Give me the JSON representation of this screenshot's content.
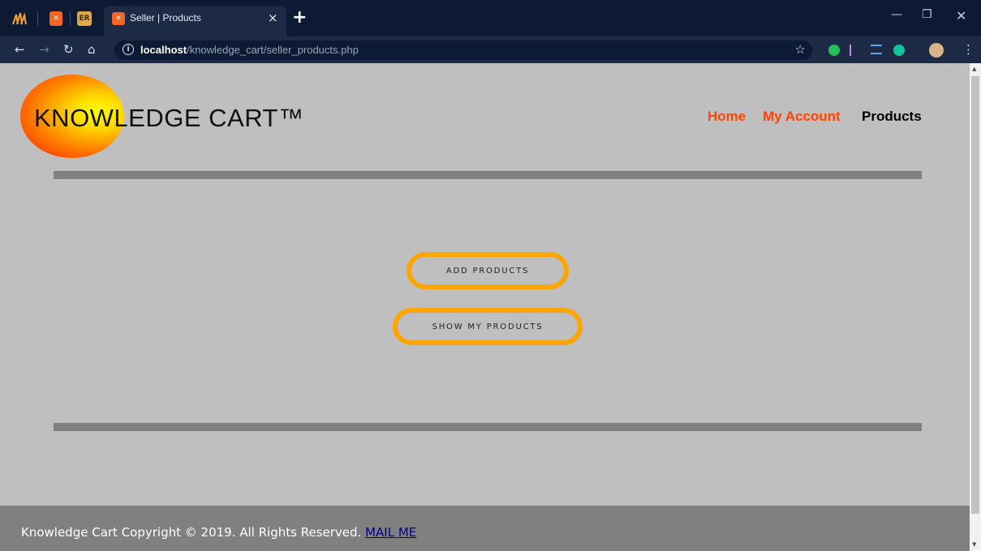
{
  "browser": {
    "tabs": [
      {
        "label": "Seller | Products",
        "active": true
      }
    ],
    "pinned_icons": [
      "xampp-icon-1",
      "xampp-icon-2",
      "er-icon"
    ],
    "pinned_er_label": "ER",
    "url_host": "localhost",
    "url_path": "/knowledge_cart/seller_products.php",
    "new_tab_symbol": "+",
    "close_symbol": "×"
  },
  "header": {
    "logo_text": "KNOWLEDGE CART™",
    "nav": [
      {
        "label": "Home",
        "color": "#ff4500"
      },
      {
        "label": "My Account",
        "color": "#ff4500"
      },
      {
        "label": "Products",
        "color": "#000000"
      }
    ]
  },
  "main": {
    "buttons": [
      {
        "label": "ADD PRODUCTS"
      },
      {
        "label": "SHOW MY PRODUCTS"
      }
    ],
    "accent_color": "#ffa500"
  },
  "footer": {
    "text": "Knowledge Cart Copyright © 2019. All Rights Reserved.",
    "link_label": "MAIL ME"
  }
}
